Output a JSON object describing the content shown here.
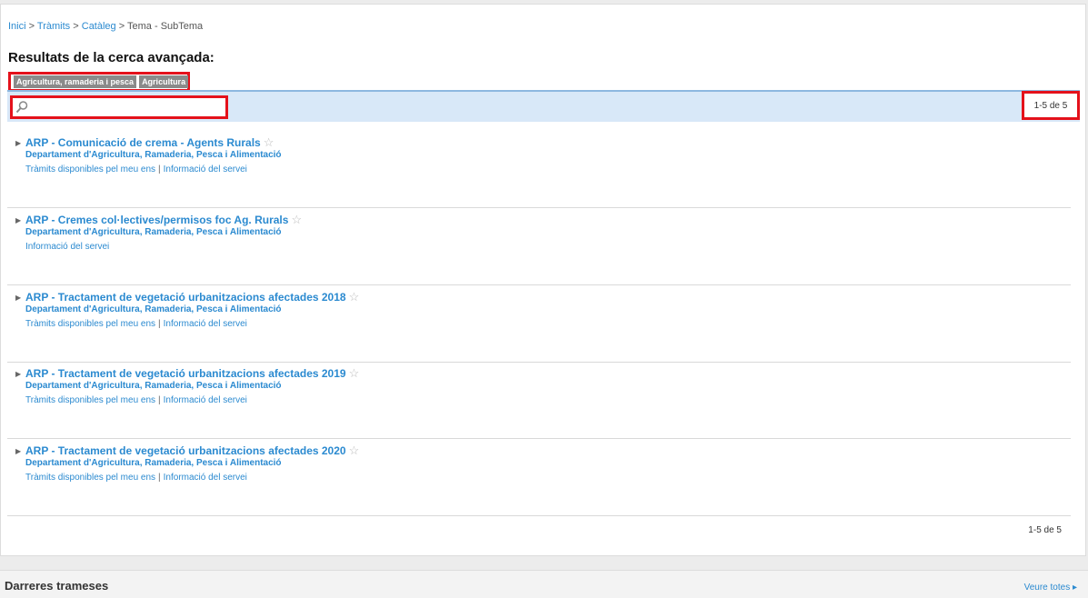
{
  "breadcrumb": {
    "items": [
      "Inici",
      "Tràmits",
      "Catàleg"
    ],
    "current": "Tema - SubTema",
    "separator": ">"
  },
  "page_title": "Resultats de la cerca avançada:",
  "tags": [
    "Agricultura, ramaderia i pesca",
    "Agricultura"
  ],
  "search": {
    "value": "",
    "placeholder": ""
  },
  "pager": {
    "top": "1-5 de 5",
    "bottom": "1-5 de 5"
  },
  "results": [
    {
      "title": "ARP - Comunicació de crema - Agents Rurals",
      "department": "Departament d'Agricultura, Ramaderia, Pesca i Alimentació",
      "links": [
        "Tràmits disponibles pel meu ens",
        "Informació del servei"
      ]
    },
    {
      "title": "ARP - Cremes col·lectives/permisos foc Ag. Rurals",
      "department": "Departament d'Agricultura, Ramaderia, Pesca i Alimentació",
      "links": [
        "Informació del servei"
      ]
    },
    {
      "title": "ARP - Tractament de vegetació urbanitzacions afectades 2018",
      "department": "Departament d'Agricultura, Ramaderia, Pesca i Alimentació",
      "links": [
        "Tràmits disponibles pel meu ens",
        "Informació del servei"
      ]
    },
    {
      "title": "ARP - Tractament de vegetació urbanitzacions afectades 2019",
      "department": "Departament d'Agricultura, Ramaderia, Pesca i Alimentació",
      "links": [
        "Tràmits disponibles pel meu ens",
        "Informació del servei"
      ]
    },
    {
      "title": "ARP - Tractament de vegetació urbanitzacions afectades 2020",
      "department": "Departament d'Agricultura, Ramaderia, Pesca i Alimentació",
      "links": [
        "Tràmits disponibles pel meu ens",
        "Informació del servei"
      ]
    }
  ],
  "bottom_section": {
    "title": "Darreres trameses",
    "see_all": "Veure totes ▸"
  },
  "colors": {
    "link": "#2b8ad0",
    "highlight": "#e4111b",
    "search_bar": "#d8e8f8"
  }
}
